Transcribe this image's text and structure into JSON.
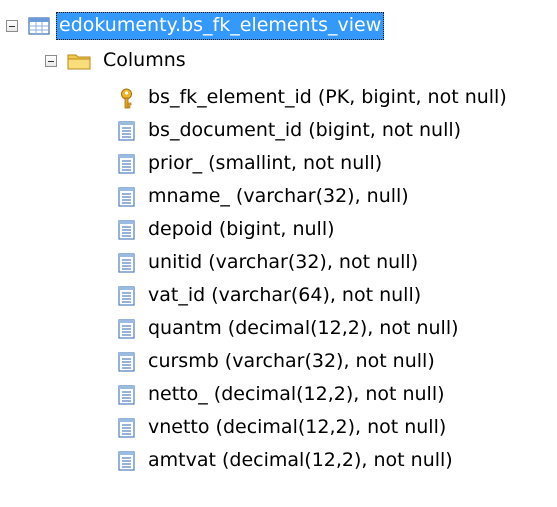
{
  "tree": {
    "root": {
      "label": "edokumenty.bs_fk_elements_view",
      "icon": "view-icon",
      "expanded": true,
      "selected": true
    },
    "folder": {
      "label": "Columns",
      "icon": "folder-icon",
      "expanded": true
    },
    "columns": [
      {
        "text": "bs_fk_element_id (PK, bigint, not null)",
        "icon": "key-icon"
      },
      {
        "text": "bs_document_id (bigint, not null)",
        "icon": "column-icon"
      },
      {
        "text": "prior_ (smallint, not null)",
        "icon": "column-icon"
      },
      {
        "text": "mname_ (varchar(32), null)",
        "icon": "column-icon"
      },
      {
        "text": "depoid (bigint, null)",
        "icon": "column-icon"
      },
      {
        "text": "unitid (varchar(32), not null)",
        "icon": "column-icon"
      },
      {
        "text": "vat_id (varchar(64), not null)",
        "icon": "column-icon"
      },
      {
        "text": "quantm (decimal(12,2), not null)",
        "icon": "column-icon"
      },
      {
        "text": "cursmb (varchar(32), not null)",
        "icon": "column-icon"
      },
      {
        "text": "netto_ (decimal(12,2), not null)",
        "icon": "column-icon"
      },
      {
        "text": "vnetto (decimal(12,2), not null)",
        "icon": "column-icon"
      },
      {
        "text": "amtvat (decimal(12,2), not null)",
        "icon": "column-icon"
      }
    ]
  },
  "colors": {
    "selection": "#3399ff",
    "key": "#e0a820",
    "folder": "#f5d66b",
    "column_icon": "#4f7fc0"
  }
}
